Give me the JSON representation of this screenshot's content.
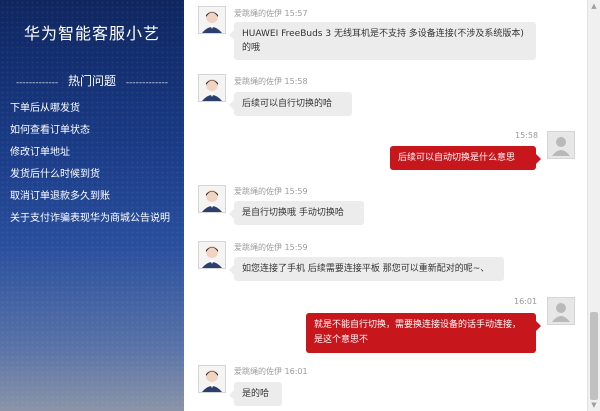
{
  "sidebar": {
    "title": "华为智能客服小艺",
    "hot_dash": "-------------",
    "hot_label": "热门问题",
    "items": [
      "下单后从哪发货",
      "如何查看订单状态",
      "修改订单地址",
      "发货后什么时候到货",
      "取消订单退款多久到账",
      "关于支付诈骗表现华为商城公告说明"
    ]
  },
  "messages": [
    {
      "from": "agent",
      "name": "爱跳绳的佐伊",
      "time": "15:57",
      "text": "HUAWEI FreeBuds 3 无线耳机是不支持 多设备连接(不涉及系统版本)的哦"
    },
    {
      "from": "agent",
      "name": "爱跳绳的佐伊",
      "time": "15:58",
      "text": "后续可以自行切换的哈"
    },
    {
      "from": "user",
      "time": "15:58",
      "text": "后续可以自动切换是什么意思"
    },
    {
      "from": "agent",
      "name": "爱跳绳的佐伊",
      "time": "15:59",
      "text": "是自行切换哦 手动切换哈"
    },
    {
      "from": "agent",
      "name": "爱跳绳的佐伊",
      "time": "15:59",
      "text": "如您连接了手机 后续需要连接平板 那您可以重新配对的呢~、"
    },
    {
      "from": "user",
      "time": "16:01",
      "text": "就是不能自行切换，需要换连接设备的话手动连接，是这个意思不"
    },
    {
      "from": "agent",
      "name": "爱跳绳的佐伊",
      "time": "16:01",
      "text": "是的哈"
    }
  ],
  "icons": {
    "scroll_up": "scroll-up-arrow-icon",
    "scroll_down": "scroll-down-arrow-icon"
  },
  "colors": {
    "sidebar_top": "#0f2660",
    "user_bubble": "#c8161d",
    "agent_bubble": "#ececec"
  }
}
